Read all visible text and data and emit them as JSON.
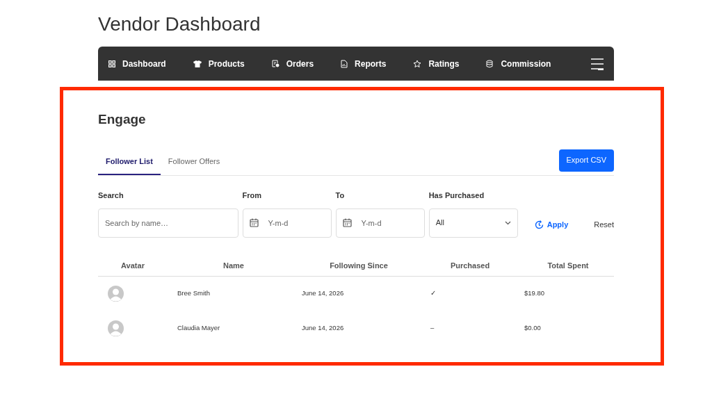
{
  "page_title": "Vendor Dashboard",
  "nav": {
    "items": [
      {
        "label": "Dashboard"
      },
      {
        "label": "Products"
      },
      {
        "label": "Orders"
      },
      {
        "label": "Reports"
      },
      {
        "label": "Ratings"
      },
      {
        "label": "Commission"
      }
    ]
  },
  "section_title": "Engage",
  "tabs": [
    {
      "label": "Follower List",
      "selected": true
    },
    {
      "label": "Follower Offers",
      "selected": false
    }
  ],
  "export_button": "Export CSV",
  "filters": {
    "search": {
      "label": "Search",
      "placeholder": "Search by name…"
    },
    "from": {
      "label": "From",
      "placeholder": "Y-m-d"
    },
    "to": {
      "label": "To",
      "placeholder": "Y-m-d"
    },
    "has_purchased": {
      "label": "Has Purchased",
      "value": "All"
    },
    "apply": "Apply",
    "reset": "Reset"
  },
  "table": {
    "columns": [
      "Avatar",
      "Name",
      "Following Since",
      "Purchased",
      "Total Spent"
    ],
    "rows": [
      {
        "name": "Bree Smith",
        "following_since": "June 14, 2026",
        "purchased": "✓",
        "total_spent": "$19.80"
      },
      {
        "name": "Claudia Mayer",
        "following_since": "June 14, 2026",
        "purchased": "–",
        "total_spent": "$0.00"
      }
    ]
  }
}
